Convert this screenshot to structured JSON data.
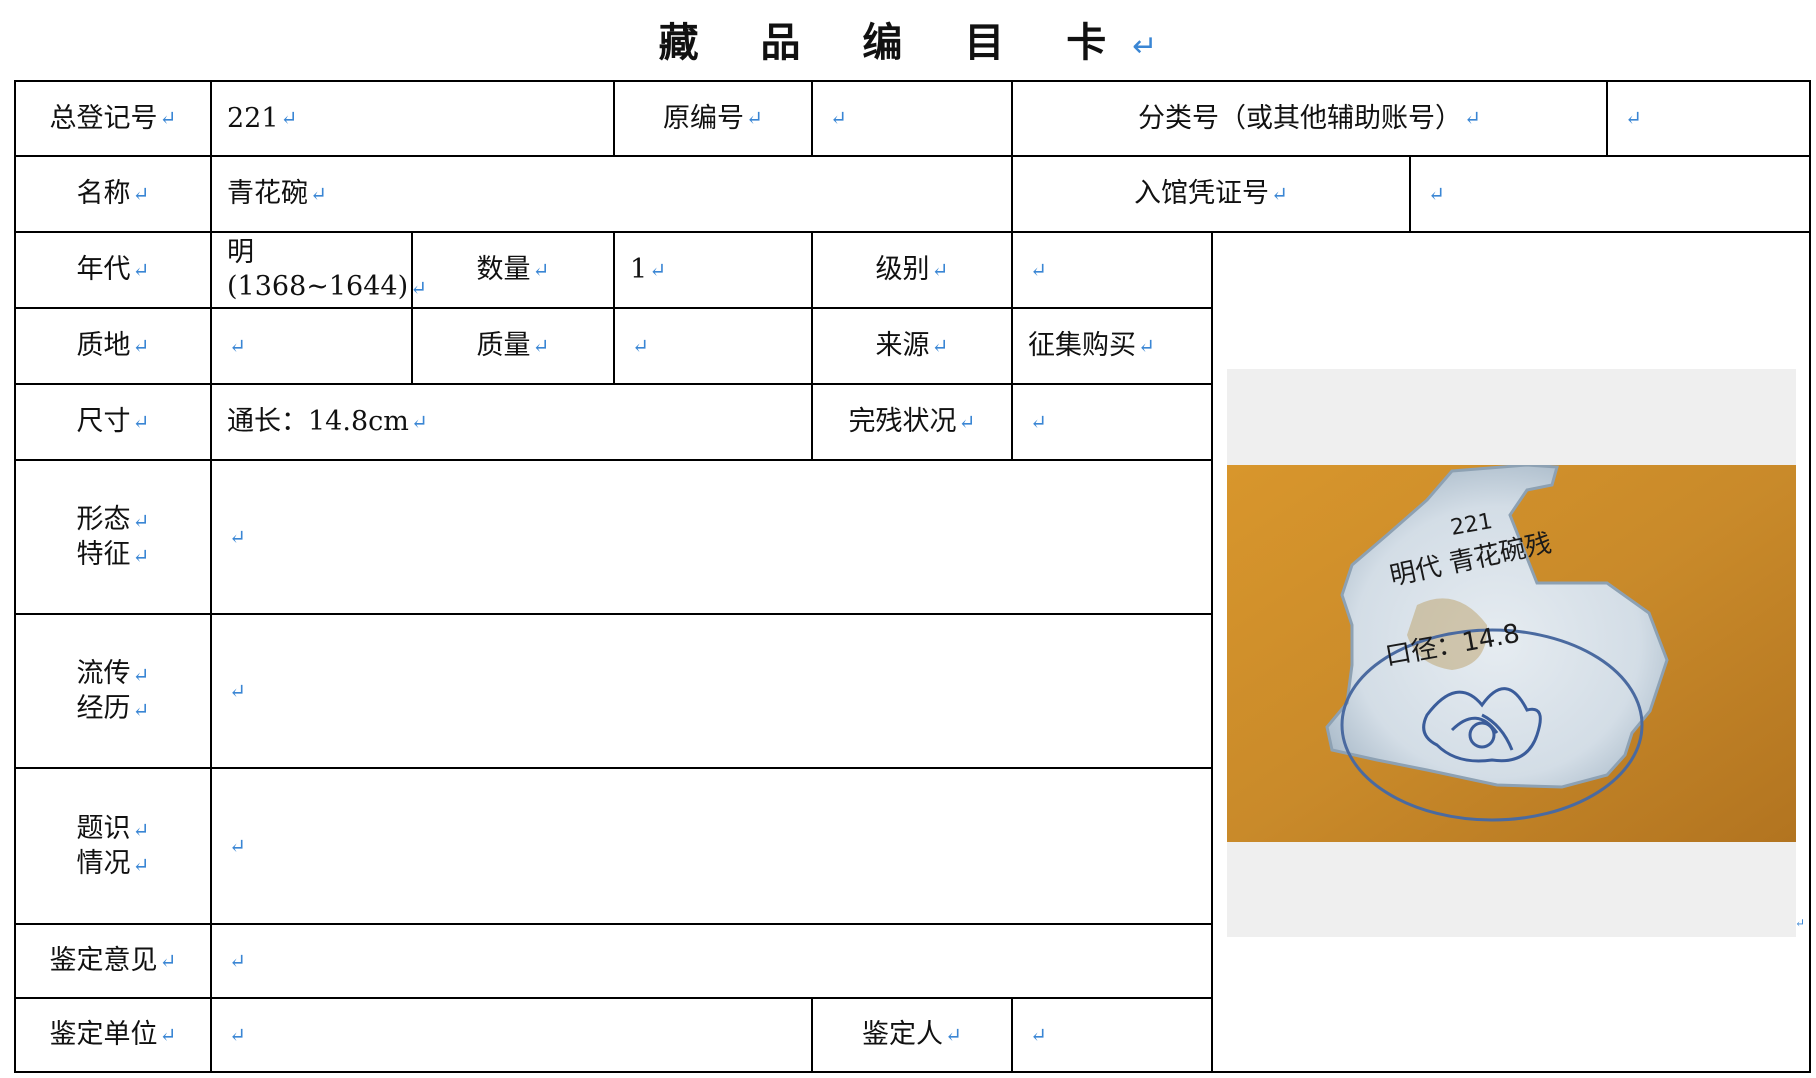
{
  "title": "藏 品 编 目 卡",
  "para_mark": "↵",
  "labels": {
    "total_reg_no": "总登记号",
    "original_no": "原编号",
    "class_no": "分类号（或其他辅助账号）",
    "name": "名称",
    "accession_voucher": "入馆凭证号",
    "era": "年代",
    "quantity": "数量",
    "grade": "级别",
    "material": "质地",
    "weight": "质量",
    "source": "来源",
    "size": "尺寸",
    "condition": "完残状况",
    "form_line1": "形态",
    "form_line2": "特征",
    "history_line1": "流传",
    "history_line2": "经历",
    "inscription_line1": "题识",
    "inscription_line2": "情况",
    "appraisal_opinion": "鉴定意见",
    "appraisal_unit": "鉴定单位",
    "appraiser": "鉴定人"
  },
  "values": {
    "total_reg_no": "221",
    "original_no": "",
    "class_no": "",
    "name": "青花碗",
    "accession_voucher": "",
    "era_line1": "明",
    "era_line2": "(1368~1644)",
    "quantity": "1",
    "grade": "",
    "material": "",
    "weight": "",
    "source": "征集购买",
    "size": "通长：14.8cm",
    "condition": "",
    "form": "",
    "history": "",
    "inscription": "",
    "appraisal_opinion": "",
    "appraisal_unit": "",
    "appraiser": ""
  },
  "photo": {
    "handwriting_line1": "221",
    "handwriting_line2": "明代 青花碗残",
    "handwriting_line3": "口径：14.8",
    "background_color": "#c98a2a",
    "shard_color": "#d9e3ec",
    "glaze_blue": "#3a5c9a"
  }
}
